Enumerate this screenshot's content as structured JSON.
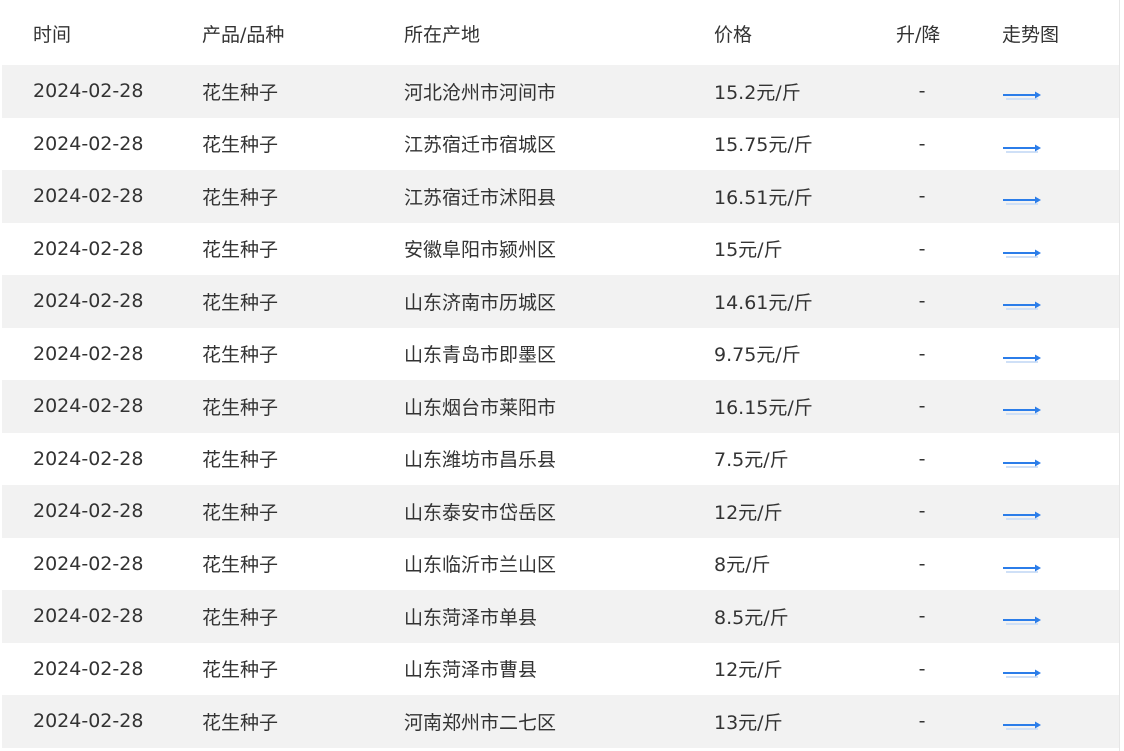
{
  "headers": {
    "date": "时间",
    "product": "产品/品种",
    "origin": "所在产地",
    "price": "价格",
    "change": "升/降",
    "trend": "走势图"
  },
  "colors": {
    "arrow": "#2b7de9",
    "stripe": "#f2f2f2"
  },
  "trend_icon": "right-arrow-icon",
  "rows": [
    {
      "date": "2024-02-28",
      "product": "花生种子",
      "origin": "河北沧州市河间市",
      "price": "15.2元/斤",
      "change": "-"
    },
    {
      "date": "2024-02-28",
      "product": "花生种子",
      "origin": "江苏宿迁市宿城区",
      "price": "15.75元/斤",
      "change": "-"
    },
    {
      "date": "2024-02-28",
      "product": "花生种子",
      "origin": "江苏宿迁市沭阳县",
      "price": "16.51元/斤",
      "change": "-"
    },
    {
      "date": "2024-02-28",
      "product": "花生种子",
      "origin": "安徽阜阳市颍州区",
      "price": "15元/斤",
      "change": "-"
    },
    {
      "date": "2024-02-28",
      "product": "花生种子",
      "origin": "山东济南市历城区",
      "price": "14.61元/斤",
      "change": "-"
    },
    {
      "date": "2024-02-28",
      "product": "花生种子",
      "origin": "山东青岛市即墨区",
      "price": "9.75元/斤",
      "change": "-"
    },
    {
      "date": "2024-02-28",
      "product": "花生种子",
      "origin": "山东烟台市莱阳市",
      "price": "16.15元/斤",
      "change": "-"
    },
    {
      "date": "2024-02-28",
      "product": "花生种子",
      "origin": "山东潍坊市昌乐县",
      "price": "7.5元/斤",
      "change": "-"
    },
    {
      "date": "2024-02-28",
      "product": "花生种子",
      "origin": "山东泰安市岱岳区",
      "price": "12元/斤",
      "change": "-"
    },
    {
      "date": "2024-02-28",
      "product": "花生种子",
      "origin": "山东临沂市兰山区",
      "price": "8元/斤",
      "change": "-"
    },
    {
      "date": "2024-02-28",
      "product": "花生种子",
      "origin": "山东菏泽市单县",
      "price": "8.5元/斤",
      "change": "-"
    },
    {
      "date": "2024-02-28",
      "product": "花生种子",
      "origin": "山东菏泽市曹县",
      "price": "12元/斤",
      "change": "-"
    },
    {
      "date": "2024-02-28",
      "product": "花生种子",
      "origin": "河南郑州市二七区",
      "price": "13元/斤",
      "change": "-"
    }
  ]
}
